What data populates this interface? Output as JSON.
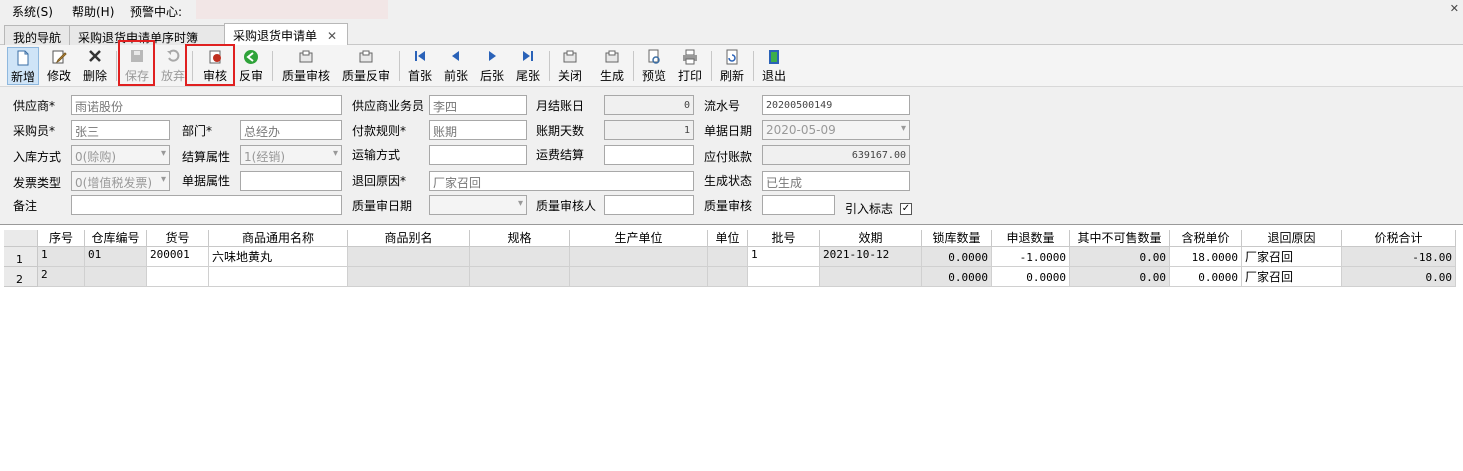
{
  "menu": {
    "system": "系统(S)",
    "help": "帮助(H)",
    "alert_center": "预警中心:",
    "close_glyph": "✕"
  },
  "tabs": [
    {
      "label": "我的导航"
    },
    {
      "label": "采购退货申请单序时簿"
    },
    {
      "label": "采购退货申请单",
      "close": "✕"
    }
  ],
  "toolbar": {
    "new": "新增",
    "edit": "修改",
    "delete": "删除",
    "save": "保存",
    "discard": "放弃",
    "audit": "审核",
    "unaudit": "反审",
    "quality_audit": "质量审核",
    "quality_unaudit": "质量反审",
    "first": "首张",
    "prev": "前张",
    "next": "后张",
    "last": "尾张",
    "close": "关闭",
    "generate": "生成",
    "preview": "预览",
    "print": "打印",
    "refresh": "刷新",
    "exit": "退出"
  },
  "icons": {
    "new": "new-document-icon",
    "edit": "edit-icon",
    "delete": "delete-x-icon",
    "save": "save-disk-icon",
    "discard": "undo-icon",
    "audit": "audit-stamp-icon",
    "unaudit": "green-back-arrow-icon",
    "first": "first-page-icon",
    "prev": "prev-arrow-icon",
    "next": "next-arrow-icon",
    "last": "last-page-icon",
    "preview": "preview-icon",
    "print": "printer-icon",
    "refresh": "refresh-icon",
    "exit": "exit-door-icon"
  },
  "form": {
    "supplier": {
      "label": "供应商*",
      "value": "雨诺股份"
    },
    "supplier_staff": {
      "label": "供应商业务员",
      "value": "李四"
    },
    "monthly_account": {
      "label": "月结账日",
      "value": "0"
    },
    "serial_no": {
      "label": "流水号",
      "value": "20200500149"
    },
    "buyer": {
      "label": "采购员*",
      "value": "张三"
    },
    "department": {
      "label": "部门*",
      "value": "总经办"
    },
    "payment_rule": {
      "label": "付款规则*",
      "value": "账期"
    },
    "account_days": {
      "label": "账期天数",
      "value": "1"
    },
    "doc_date": {
      "label": "单据日期",
      "value": "2020-05-09"
    },
    "stock_in_method": {
      "label": "入库方式",
      "value": "0(赊购)"
    },
    "settle_attr": {
      "label": "结算属性",
      "value": "1(经销)"
    },
    "transport": {
      "label": "运输方式",
      "value": ""
    },
    "freight": {
      "label": "运费结算",
      "value": ""
    },
    "payable": {
      "label": "应付账款",
      "value": "639167.00"
    },
    "invoice_type": {
      "label": "发票类型",
      "value": "0(增值税发票)"
    },
    "doc_attr": {
      "label": "单据属性",
      "value": ""
    },
    "return_reason": {
      "label": "退回原因*",
      "value": "厂家召回"
    },
    "gen_status": {
      "label": "生成状态",
      "value": "已生成"
    },
    "remark": {
      "label": "备注",
      "value": ""
    },
    "quality_date": {
      "label": "质量审日期",
      "value": ""
    },
    "quality_auditor": {
      "label": "质量审核人",
      "value": ""
    },
    "quality_audit": {
      "label": "质量审核",
      "value": ""
    },
    "import_flag": {
      "label": "引入标志",
      "checked": "✓"
    }
  },
  "grid": {
    "headers": [
      "序号",
      "仓库编号",
      "货号",
      "商品通用名称",
      "商品别名",
      "规格",
      "生产单位",
      "单位",
      "批号",
      "效期",
      "锁库数量",
      "申退数量",
      "其中不可售数量",
      "含税单价",
      "退回原因",
      "价税合计"
    ],
    "rows": [
      {
        "row_no": "1",
        "cells": [
          "1",
          "01",
          "200001",
          "六味地黄丸",
          "",
          "",
          "",
          "",
          "1",
          "2021-10-12",
          "0.0000",
          "-1.0000",
          "0.00",
          "18.0000",
          "厂家召回",
          "-18.00"
        ]
      },
      {
        "row_no": "2",
        "cells": [
          "2",
          "",
          "",
          "",
          "",
          "",
          "",
          "",
          "",
          "",
          "0.0000",
          "0.0000",
          "0.00",
          "0.0000",
          "厂家召回",
          "0.00"
        ]
      }
    ]
  }
}
